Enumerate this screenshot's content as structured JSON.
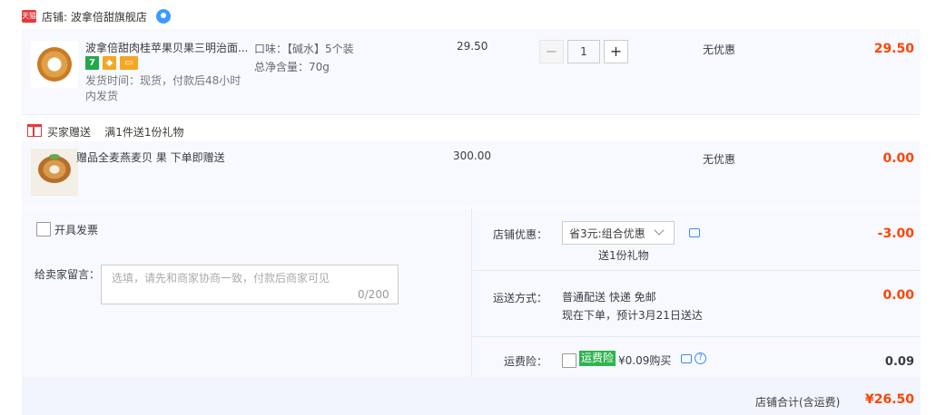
{
  "shop": {
    "label": "店铺: 波拿倍甜旗舰店",
    "badge": "天猫",
    "colors": {
      "accent": "#ff4400",
      "badge": "#e4393c"
    }
  },
  "item": {
    "title": "波拿倍甜肉桂苹果贝果三明治面...",
    "icons": [
      "7",
      "g",
      "c"
    ],
    "delivery": "发货时间：现货，付款后48小时内发货",
    "sku_flavor": "口味：【碱水】5个装",
    "sku_weight": "总净含量：70g",
    "unit_price": "29.50",
    "qty": "1",
    "minus": "−",
    "plus": "+",
    "promo": "无优惠",
    "total": "29.50"
  },
  "gift": {
    "header": "买家赠送",
    "rule": "满1件送1份礼物",
    "title": "赠品全麦燕麦贝 果 下单即赠送",
    "price": "300.00",
    "promo": "无优惠",
    "total": "0.00"
  },
  "order": {
    "invoice": "开具发票",
    "memo_label": "给卖家留言：",
    "memo_placeholder": "选填，请先和商家协商一致，付款后商家可见",
    "memo_count": "0/200",
    "shop_discount_label": "店铺优惠：",
    "shop_discount_select": "省3元:组合优惠",
    "shop_discount_gift": "送1份礼物",
    "shop_discount_value": "-3.00",
    "shipping_label": "运送方式：",
    "shipping_method": "普通配送 快递 免邮",
    "shipping_eta": "现在下单，预计3月21日送达",
    "shipping_value": "0.00",
    "insurance_label": "运费险：",
    "insurance_badge": "运费险",
    "insurance_text": "¥0.09购买",
    "insurance_value": "0.09"
  },
  "footer": {
    "total_label": "店铺合计(含运费)",
    "total_value": "¥26.50"
  }
}
